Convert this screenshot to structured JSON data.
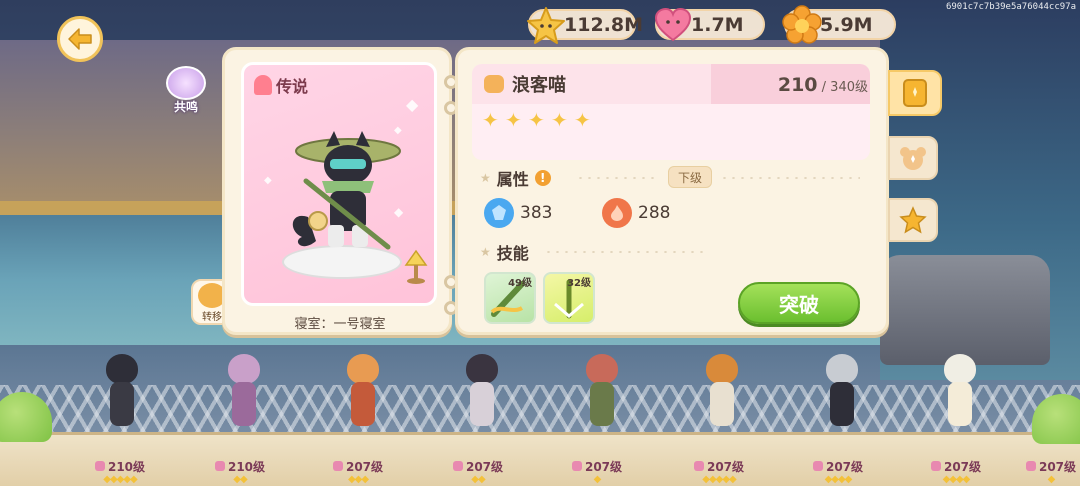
{
  "session_id": "6901c7c7b39e5a76044cc97a",
  "currencies": [
    {
      "icon": "star-currency-icon",
      "value": "112.8M",
      "color": "#f6c445"
    },
    {
      "icon": "heart-currency-icon",
      "value": "1.7M",
      "color": "#f47aa0"
    },
    {
      "icon": "flower-currency-icon",
      "value": "5.9M",
      "color": "#f6a232"
    }
  ],
  "resonance_label": "共鸣",
  "transfer_label": "转移",
  "card": {
    "rarity": "传说",
    "dorm": "寝室：一号寝室"
  },
  "detail": {
    "name": "浪客喵",
    "level_current": "210",
    "level_max": "/ 340级",
    "stars": 5,
    "attr_label": "属性",
    "next_level_label": "下级",
    "stats": [
      {
        "icon": "blue-gem-icon",
        "value": "383",
        "color": "#4aa8f0"
      },
      {
        "icon": "fire-icon",
        "value": "288",
        "color": "#f0764a"
      }
    ],
    "skills_label": "技能",
    "skills": [
      {
        "level": "49级"
      },
      {
        "level": "32级"
      }
    ],
    "breakthrough_label": "突破"
  },
  "roster": [
    {
      "level": "210级",
      "stars": "◆◆◆◆◆"
    },
    {
      "level": "210级",
      "stars": "◆◆"
    },
    {
      "level": "207级",
      "stars": "◆◆◆"
    },
    {
      "level": "207级",
      "stars": "◆◆"
    },
    {
      "level": "207级",
      "stars": "◆"
    },
    {
      "level": "207级",
      "stars": "◆◆◆◆◆"
    },
    {
      "level": "207级",
      "stars": "◆◆◆◆"
    },
    {
      "level": "207级",
      "stars": "◆◆◆◆"
    },
    {
      "level": "207级",
      "stars": "◆"
    }
  ]
}
